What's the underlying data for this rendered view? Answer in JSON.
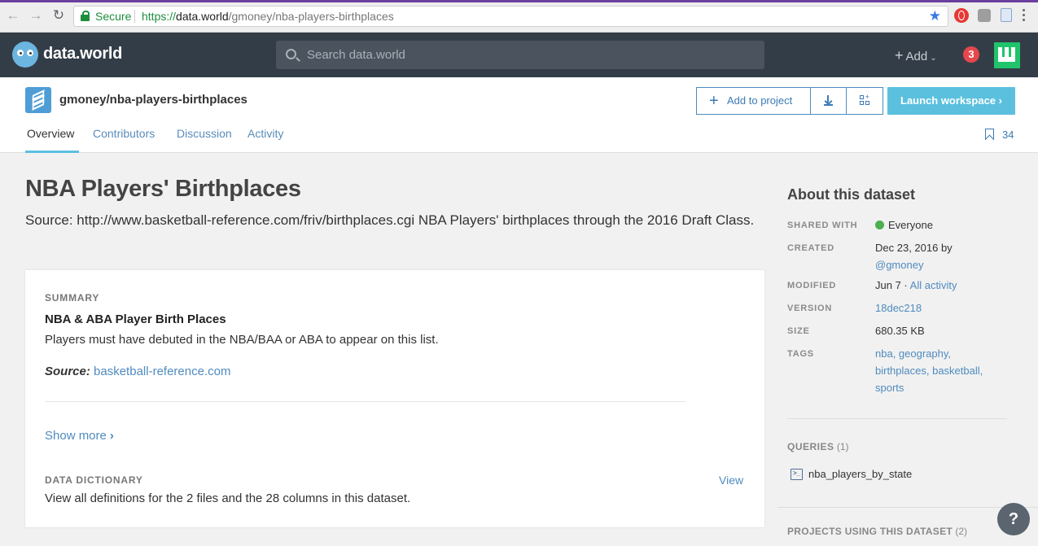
{
  "browser": {
    "secure_label": "Secure",
    "url_scheme": "https://",
    "url_host": "data.world",
    "url_path": "/gmoney/nba-players-birthplaces"
  },
  "appbar": {
    "brand": "data.world",
    "search_placeholder": "Search data.world",
    "add_label": "Add",
    "notification_count": "3"
  },
  "dataset_header": {
    "title": "gmoney/nba-players-birthplaces",
    "add_to_project": "Add to project",
    "launch_workspace": "Launch workspace",
    "tabs": [
      {
        "label": "Overview",
        "active": true
      },
      {
        "label": "Contributors",
        "active": false
      },
      {
        "label": "Discussion",
        "active": false
      },
      {
        "label": "Activity",
        "active": false
      }
    ],
    "bookmark_count": "34"
  },
  "main": {
    "title": "NBA Players' Birthplaces",
    "description": "Source: http://www.basketball-reference.com/friv/birthplaces.cgi NBA Players' birthplaces through the 2016 Draft Class.",
    "card": {
      "summary_label": "SUMMARY",
      "summary_title": "NBA & ABA Player Birth Places",
      "summary_body": "Players must have debuted in the NBA/BAA or ABA to appear on this list.",
      "source_label": "Source:",
      "source_link": "basketball-reference.com",
      "show_more": "Show more",
      "data_dictionary_label": "DATA DICTIONARY",
      "data_dictionary_body": "View all definitions for the 2 files and the 28 columns in this dataset.",
      "view_link": "View"
    }
  },
  "sidebar": {
    "about_title": "About this dataset",
    "shared_with_label": "SHARED WITH",
    "shared_with": "Everyone",
    "created_label": "CREATED",
    "created_date": "Dec 23, 2016 by",
    "created_by": "@gmoney",
    "modified_label": "MODIFIED",
    "modified_date": "Jun 7 ·",
    "modified_link": "All activity",
    "version_label": "VERSION",
    "version": "18dec218",
    "size_label": "SIZE",
    "size": "680.35 KB",
    "tags_label": "TAGS",
    "tags_line1": "nba, geography,",
    "tags_line2": "birthplaces, basketball,",
    "tags_line3": "sports",
    "queries_label": "QUERIES",
    "queries_count": "(1)",
    "query_name": "nba_players_by_state",
    "projects_label": "PROJECTS USING THIS DATASET",
    "projects_count": "(2)"
  },
  "help_label": "?",
  "colors": {
    "appbar": "#333d47",
    "accent": "#5bc0de",
    "link": "#4f8bbf",
    "badge": "#e6474d",
    "avatar": "#1fc46b"
  }
}
